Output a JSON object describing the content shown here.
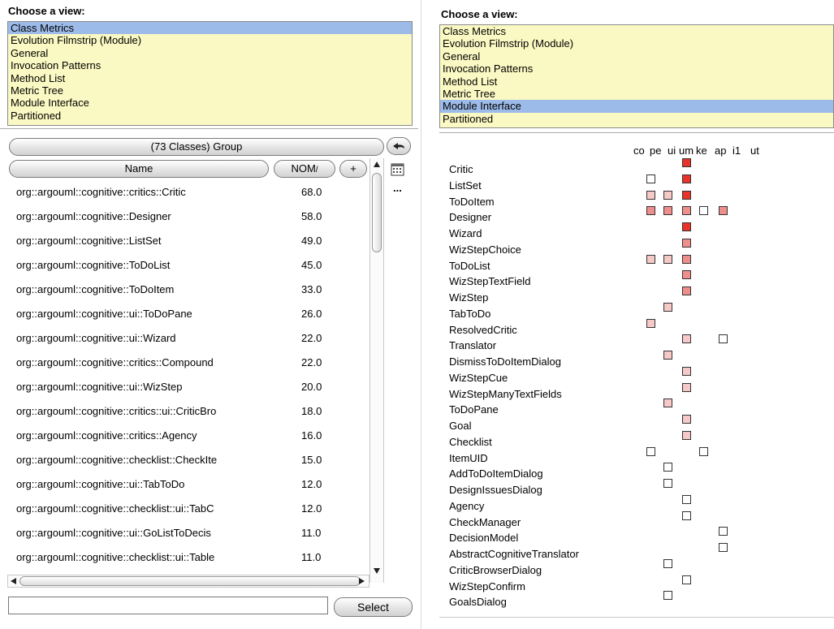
{
  "colors": {
    "list_bg": "#fbf9c3",
    "selected_bg": "#9dbbe9",
    "cell_high": "#e8322a",
    "cell_medium": "#ef8f8c",
    "cell_low": "#f6c9c8",
    "cell_empty": "#ffffff"
  },
  "left_panel": {
    "view_label": "Choose a view:",
    "views": [
      "Class Metrics",
      "Evolution Filmstrip (Module)",
      "General",
      "Invocation Patterns",
      "Method List",
      "Metric Tree",
      "Module Interface",
      "Partitioned"
    ],
    "selected_view": "Class Metrics",
    "group_button": "(73 Classes) Group",
    "columns": {
      "name": "Name",
      "metric": "NOM",
      "sort_indicator": "/",
      "add": "+"
    },
    "rows": [
      {
        "name": "org::argouml::cognitive::critics::Critic",
        "value": "68.0"
      },
      {
        "name": "org::argouml::cognitive::Designer",
        "value": "58.0"
      },
      {
        "name": "org::argouml::cognitive::ListSet",
        "value": "49.0"
      },
      {
        "name": "org::argouml::cognitive::ToDoList",
        "value": "45.0"
      },
      {
        "name": "org::argouml::cognitive::ToDoItem",
        "value": "33.0"
      },
      {
        "name": "org::argouml::cognitive::ui::ToDoPane",
        "value": "26.0"
      },
      {
        "name": "org::argouml::cognitive::ui::Wizard",
        "value": "22.0"
      },
      {
        "name": "org::argouml::cognitive::critics::Compound",
        "value": "22.0"
      },
      {
        "name": "org::argouml::cognitive::ui::WizStep",
        "value": "20.0"
      },
      {
        "name": "org::argouml::cognitive::critics::ui::CriticBro",
        "value": "18.0"
      },
      {
        "name": "org::argouml::cognitive::critics::Agency",
        "value": "16.0"
      },
      {
        "name": "org::argouml::cognitive::checklist::CheckIte",
        "value": "15.0"
      },
      {
        "name": "org::argouml::cognitive::ui::TabToDo",
        "value": "12.0"
      },
      {
        "name": "org::argouml::cognitive::checklist::ui::TabC",
        "value": "12.0"
      },
      {
        "name": "org::argouml::cognitive::ui::GoListToDecis",
        "value": "11.0"
      },
      {
        "name": "org::argouml::cognitive::checklist::ui::Table",
        "value": "11.0"
      }
    ],
    "side_menu": "...",
    "select_button": "Select",
    "search_value": ""
  },
  "right_panel": {
    "view_label": "Choose a view:",
    "views": [
      "Class Metrics",
      "Evolution Filmstrip (Module)",
      "General",
      "Invocation Patterns",
      "Method List",
      "Metric Tree",
      "Module Interface",
      "Partitioned"
    ],
    "selected_view": "Module Interface",
    "headers": [
      "co",
      "pe",
      "ui",
      "um",
      "ke",
      "ap",
      "i1",
      "ut"
    ],
    "matrix": [
      {
        "name": "Critic",
        "cells": {
          "um": "high"
        }
      },
      {
        "name": "ListSet",
        "cells": {
          "co": "empty",
          "um": "high"
        }
      },
      {
        "name": "ToDoItem",
        "cells": {
          "co": "low",
          "pe": "low",
          "um": "high"
        }
      },
      {
        "name": "Designer",
        "cells": {
          "co": "medium",
          "pe": "medium",
          "um": "medium",
          "ke": "empty",
          "ap": "medium"
        }
      },
      {
        "name": "Wizard",
        "cells": {
          "um": "high"
        }
      },
      {
        "name": "WizStepChoice",
        "cells": {
          "um": "medium"
        }
      },
      {
        "name": "ToDoList",
        "cells": {
          "co": "low",
          "pe": "low",
          "um": "medium"
        }
      },
      {
        "name": "WizStepTextField",
        "cells": {
          "um": "medium"
        }
      },
      {
        "name": "WizStep",
        "cells": {
          "um": "medium"
        }
      },
      {
        "name": "TabToDo",
        "cells": {
          "pe": "low"
        }
      },
      {
        "name": "ResolvedCritic",
        "cells": {
          "co": "low"
        }
      },
      {
        "name": "Translator",
        "cells": {
          "um": "low",
          "i1": "empty"
        }
      },
      {
        "name": "DismissToDoItemDialog",
        "cells": {
          "pe": "low"
        }
      },
      {
        "name": "WizStepCue",
        "cells": {
          "um": "low"
        }
      },
      {
        "name": "WizStepManyTextFields",
        "cells": {
          "um": "low"
        }
      },
      {
        "name": "ToDoPane",
        "cells": {
          "pe": "low"
        }
      },
      {
        "name": "Goal",
        "cells": {
          "um": "low"
        }
      },
      {
        "name": "Checklist",
        "cells": {
          "um": "low"
        }
      },
      {
        "name": "ItemUID",
        "cells": {
          "co": "empty",
          "ke": "empty"
        }
      },
      {
        "name": "AddToDoItemDialog",
        "cells": {
          "pe": "empty"
        }
      },
      {
        "name": "DesignIssuesDialog",
        "cells": {
          "pe": "empty"
        }
      },
      {
        "name": "Agency",
        "cells": {
          "um": "empty"
        }
      },
      {
        "name": "CheckManager",
        "cells": {
          "um": "empty"
        }
      },
      {
        "name": "DecisionModel",
        "cells": {
          "i1": "empty"
        }
      },
      {
        "name": "AbstractCognitiveTranslator",
        "cells": {
          "i1": "empty"
        }
      },
      {
        "name": "CriticBrowserDialog",
        "cells": {
          "pe": "empty"
        }
      },
      {
        "name": "WizStepConfirm",
        "cells": {
          "um": "empty"
        }
      },
      {
        "name": "GoalsDialog",
        "cells": {
          "pe": "empty"
        }
      }
    ]
  }
}
